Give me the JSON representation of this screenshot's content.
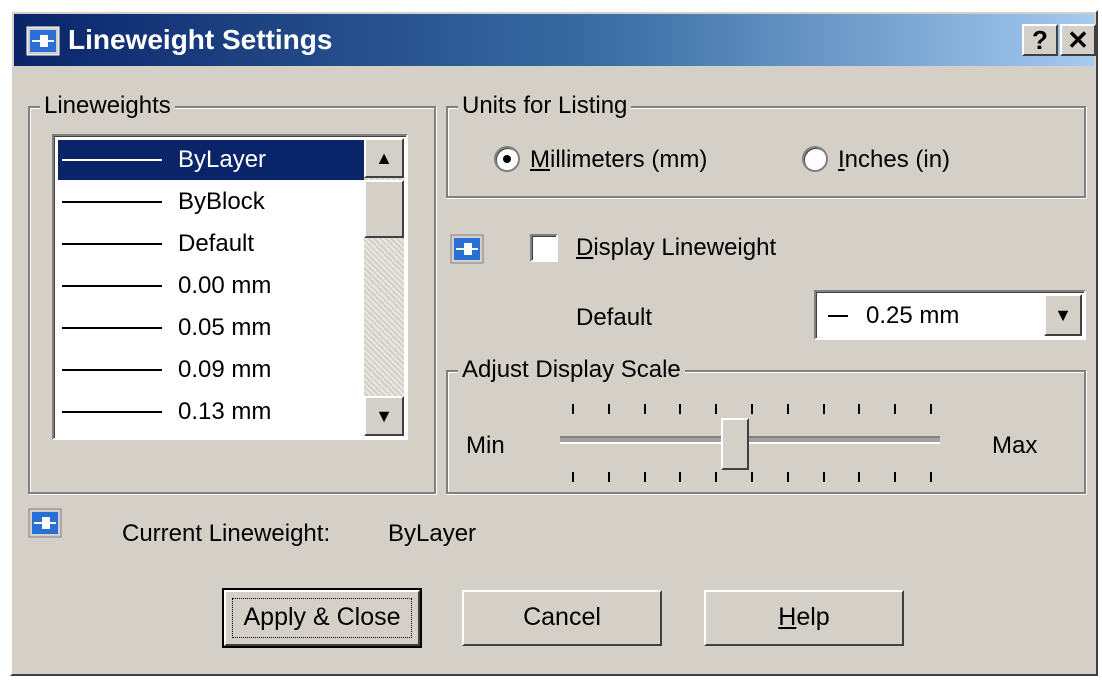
{
  "window": {
    "title": "Lineweight Settings",
    "help_button": "?",
    "close_button": "✕",
    "icon": "lineweight-app-icon"
  },
  "lineweights": {
    "group_label": "Lineweights",
    "items": [
      "ByLayer",
      "ByBlock",
      "Default",
      "0.00 mm",
      "0.05 mm",
      "0.09 mm",
      "0.13 mm"
    ],
    "selected": "ByLayer"
  },
  "units": {
    "group_label": "Units for Listing",
    "options": [
      {
        "label": "Millimeters (mm)",
        "mnemonic": "M",
        "selected": true
      },
      {
        "label": "Inches (in)",
        "mnemonic": "I",
        "selected": false
      }
    ]
  },
  "display": {
    "checkbox_label": "Display Lineweight",
    "mnemonic": "D",
    "checked": false,
    "default_label": "Default",
    "default_value": "0.25 mm"
  },
  "scale": {
    "group_label": "Adjust Display Scale",
    "min_label": "Min",
    "max_label": "Max",
    "tick_count": 11,
    "value_fraction": 0.45
  },
  "current": {
    "label": "Current Lineweight:",
    "value": "ByLayer"
  },
  "buttons": {
    "apply": "Apply & Close",
    "cancel": "Cancel",
    "help": "Help",
    "help_mnemonic": "H"
  }
}
